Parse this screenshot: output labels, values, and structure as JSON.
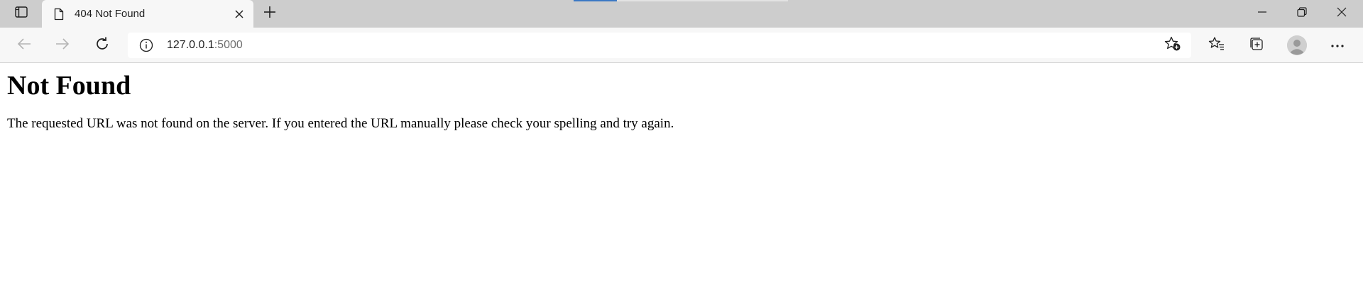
{
  "tab": {
    "title": "404 Not Found"
  },
  "address_bar": {
    "url_host": "127.0.0.1",
    "url_port": ":5000"
  },
  "page": {
    "heading": "Not Found",
    "message": "The requested URL was not found on the server. If you entered the URL manually please check your spelling and try again."
  },
  "icons": {
    "tab_actions": "tab-actions-icon",
    "favicon": "document-icon",
    "close": "close-icon",
    "new_tab": "plus-icon",
    "minimize": "minimize-icon",
    "restore": "restore-icon",
    "window_close": "close-icon",
    "back": "back-arrow-icon",
    "forward": "forward-arrow-icon",
    "refresh": "refresh-icon",
    "info": "info-icon",
    "add_favorite": "star-add-icon",
    "favorites": "favorites-icon",
    "collections": "collections-icon",
    "profile": "profile-icon",
    "more": "more-icon"
  },
  "colors": {
    "tabstrip_bg": "#cdcdcd",
    "toolbar_bg": "#f7f7f7",
    "drag_indicator": "#3b78c4"
  }
}
